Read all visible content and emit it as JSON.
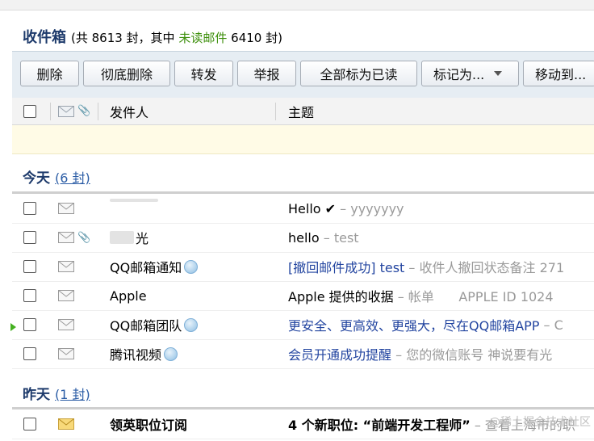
{
  "header": {
    "title": "收件箱",
    "summary_prefix": "(共 8613 封，其中",
    "unread_label": "未读邮件",
    "summary_suffix": "6410 封)"
  },
  "toolbar": {
    "delete": "删除",
    "delete_permanent": "彻底删除",
    "forward": "转发",
    "report": "举报",
    "mark_all_read": "全部标为已读",
    "mark_as": "标记为...",
    "move_to": "移动到..."
  },
  "columns": {
    "sender": "发件人",
    "subject": "主题"
  },
  "groups": {
    "today": {
      "label": "今天",
      "count": "(6 封)"
    },
    "yesterday": {
      "label": "昨天",
      "count": "(1 封)"
    }
  },
  "today_rows": [
    {
      "sender": "",
      "subject": "Hello ✔",
      "preview": "– yyyyyyy"
    },
    {
      "sender": "光",
      "subject": "hello",
      "preview": "– test"
    },
    {
      "sender": "QQ邮箱通知",
      "subject": "[撤回邮件成功] test",
      "preview": "– 收件人撤回状态备注 271"
    },
    {
      "sender": "Apple",
      "subject": "Apple 提供的收据",
      "preview": "– 帐单      APPLE ID 1024"
    },
    {
      "sender": "QQ邮箱团队",
      "subject": "更安全、更高效、更强大，尽在QQ邮箱APP",
      "preview": "– C"
    },
    {
      "sender": "腾讯视频",
      "subject": "会员开通成功提醒",
      "preview": "– 您的微信账号 神说要有光"
    }
  ],
  "yesterday_rows": [
    {
      "sender": "领英职位订阅",
      "subject": "4 个新职位: “前端开发工程师”",
      "preview": "– 查看上海市的职"
    }
  ],
  "watermark": "@稀土掘金技术社区",
  "colors": {
    "title": "#1d3a6b",
    "unread": "#3d8f0b",
    "link": "#2345a0",
    "preview": "#9a9a9a"
  }
}
